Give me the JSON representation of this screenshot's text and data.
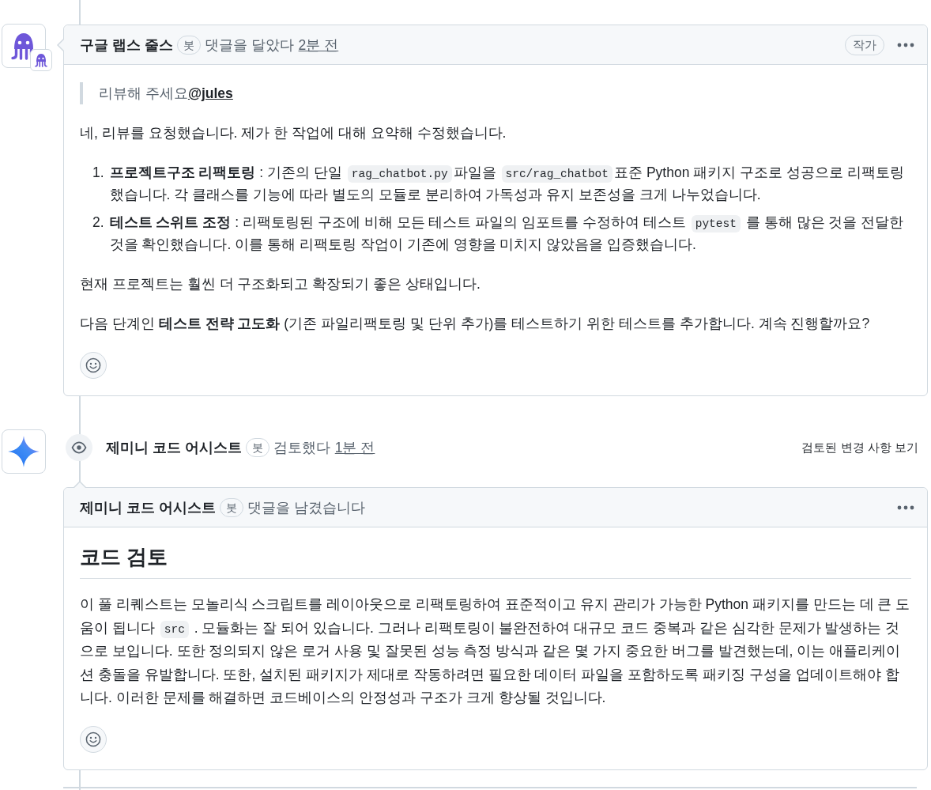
{
  "timeline": [
    {
      "kind": "comment",
      "author": "구글 랩스 줄스",
      "badge": "봇",
      "action": "댓글을 달았다",
      "time": "2분 전",
      "role": "작가",
      "body": [
        {
          "kind": "quote",
          "text": "리뷰해 주세요",
          "mention": "@jules"
        },
        {
          "kind": "paragraph",
          "parts": [
            {
              "text": "네, 리뷰를 요청했습니다. 제가 한 작업에 대해 요약해 수정했습니다."
            }
          ]
        },
        {
          "kind": "ordered_list",
          "items": [
            {
              "number": "1.",
              "parts": [
                {
                  "text": "**프로젝트구조 리팩토링** : 기존의 단일 "
                },
                {
                  "code": "rag_chatbot.py"
                },
                {
                  "text": "파일을 "
                },
                {
                  "code": "src/rag_chatbot"
                },
                {
                  "text": "표준 Python 패키지 구조로 성공으로 리팩토링했습니다. 각 클래스를 기능에 따라 별도의 모듈로 분리하여 가독성과 유지 보존성을 크게 나누었습니다."
                }
              ]
            },
            {
              "number": "2.",
              "parts": [
                {
                  "text": "**테스트 스위트 조정** : 리팩토링된 구조에 비해 모든 테스트 파일의 임포트를 수정하여 테스트 "
                },
                {
                  "code": "pytest"
                },
                {
                  "text": " 를 통해 많은 것을 전달한 것을 확인했습니다. 이를 통해 리팩토링 작업이 기존에 영향을 미치지 않았음을 입증했습니다."
                }
              ]
            }
          ]
        },
        {
          "kind": "paragraph",
          "parts": [
            {
              "text": "현재 프로젝트는 훨씬 더 구조화되고 확장되기 좋은 상태입니다."
            }
          ]
        },
        {
          "kind": "paragraph",
          "parts": [
            {
              "text": "다음 단계인 **테스트 전략 고도화** (기존 파일리팩토링 및 단위 추가)를 테스트하기 위한 테스트를 추가합니다. 계속 진행할까요?"
            }
          ]
        }
      ]
    },
    {
      "kind": "review",
      "author": "제미니 코드 어시스트",
      "badge": "봇",
      "action": "검토했다",
      "time": "1분 전",
      "link": "검토된 변경 사항 보기",
      "comment": {
        "author": "제미니 코드 어시스트",
        "badge": "봇",
        "action": "댓글을 남겼습니다",
        "body": [
          {
            "kind": "heading",
            "text": "코드 검토"
          },
          {
            "kind": "paragraph",
            "parts": [
              {
                "text": "이 풀 리퀘스트는 모놀리식 스크립트를 레이아웃으로 리팩토링하여 표준적이고 유지 관리가 가능한 Python 패키지를 만드는 데 큰 도움이 됩니다 "
              },
              {
                "code": "src"
              },
              {
                "text": " . 모듈화는 잘 되어 있습니다. 그러나 리팩토링이 불완전하여 대규모 코드 중복과 같은 심각한 문제가 발생하는 것으로 보입니다. 또한 정의되지 않은 로거 사용 및 잘못된 성능 측정 방식과 같은 몇 가지 중요한 버그를 발견했는데, 이는 애플리케이션 충돌을 유발합니다. 또한, 설치된 패키지가 제대로 작동하려면 필요한 데이터 파일을 포함하도록 패키징 구성을 업데이트해야 합니다. 이러한 문제를 해결하면 코드베이스의 안정성과 구조가 크게 향상될 것입니다."
              }
            ]
          }
        ]
      }
    }
  ]
}
